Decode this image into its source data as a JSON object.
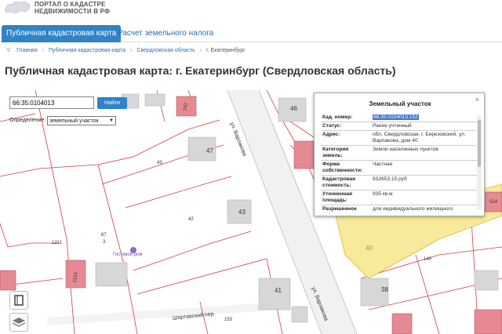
{
  "header": {
    "logo_line1": "ПОРТАЛ О КАДАСТРЕ",
    "logo_line2": "НЕДВИЖИМОСТИ В РФ"
  },
  "tabs": [
    {
      "label": "Публичная кадастровая карта",
      "active": true
    },
    {
      "label": "Расчет земельного налога",
      "active": false
    }
  ],
  "breadcrumb": [
    "Главная",
    "Публичная кадастровая карта",
    "Свердловская область",
    "г. Екатеринбург"
  ],
  "page_title": "Публичная кадастровая карта: г. Екатеринбург (Свердловская область)",
  "search": {
    "value": "66:35:0104013",
    "button_label": "Найти"
  },
  "definition": {
    "label": "Определение:",
    "selected": "земельный участок"
  },
  "map": {
    "parcel_labels": [
      "43",
      "42",
      "1211",
      "153",
      "149",
      "40",
      "41"
    ],
    "building_labels": [
      "47",
      "43",
      "46",
      "38",
      "67",
      "3",
      "1214",
      "142",
      "514"
    ],
    "street_labels": [
      "ул. Варлакова",
      "ул. Варлакова",
      "Шартавский пер."
    ],
    "poi_label": "Гостевой дом",
    "selected_parcel_color": "#f7ea9a"
  },
  "popup": {
    "title": "Земельный участок",
    "close": "×",
    "rows": [
      {
        "key": "Кад. номер:",
        "value": "66:35:0104013:152",
        "highlight": true
      },
      {
        "key": "Статус:",
        "value": "Ранее учтенный"
      },
      {
        "key": "Адрес:",
        "value": "обл. Свердловская, г. Березовский, ул. Варлакова, дом 40"
      },
      {
        "key": "Категория земель:",
        "value": "Земли населенных пунктов"
      },
      {
        "key": "Форма собственности:",
        "value": "Частная"
      },
      {
        "key": "Кадастровая стоимость:",
        "value": "932653.15 руб"
      },
      {
        "key": "Уточненная площадь:",
        "value": "935 кв.м"
      },
      {
        "key": "Разрешенное",
        "value": "для индивидуального жилищного"
      }
    ]
  }
}
